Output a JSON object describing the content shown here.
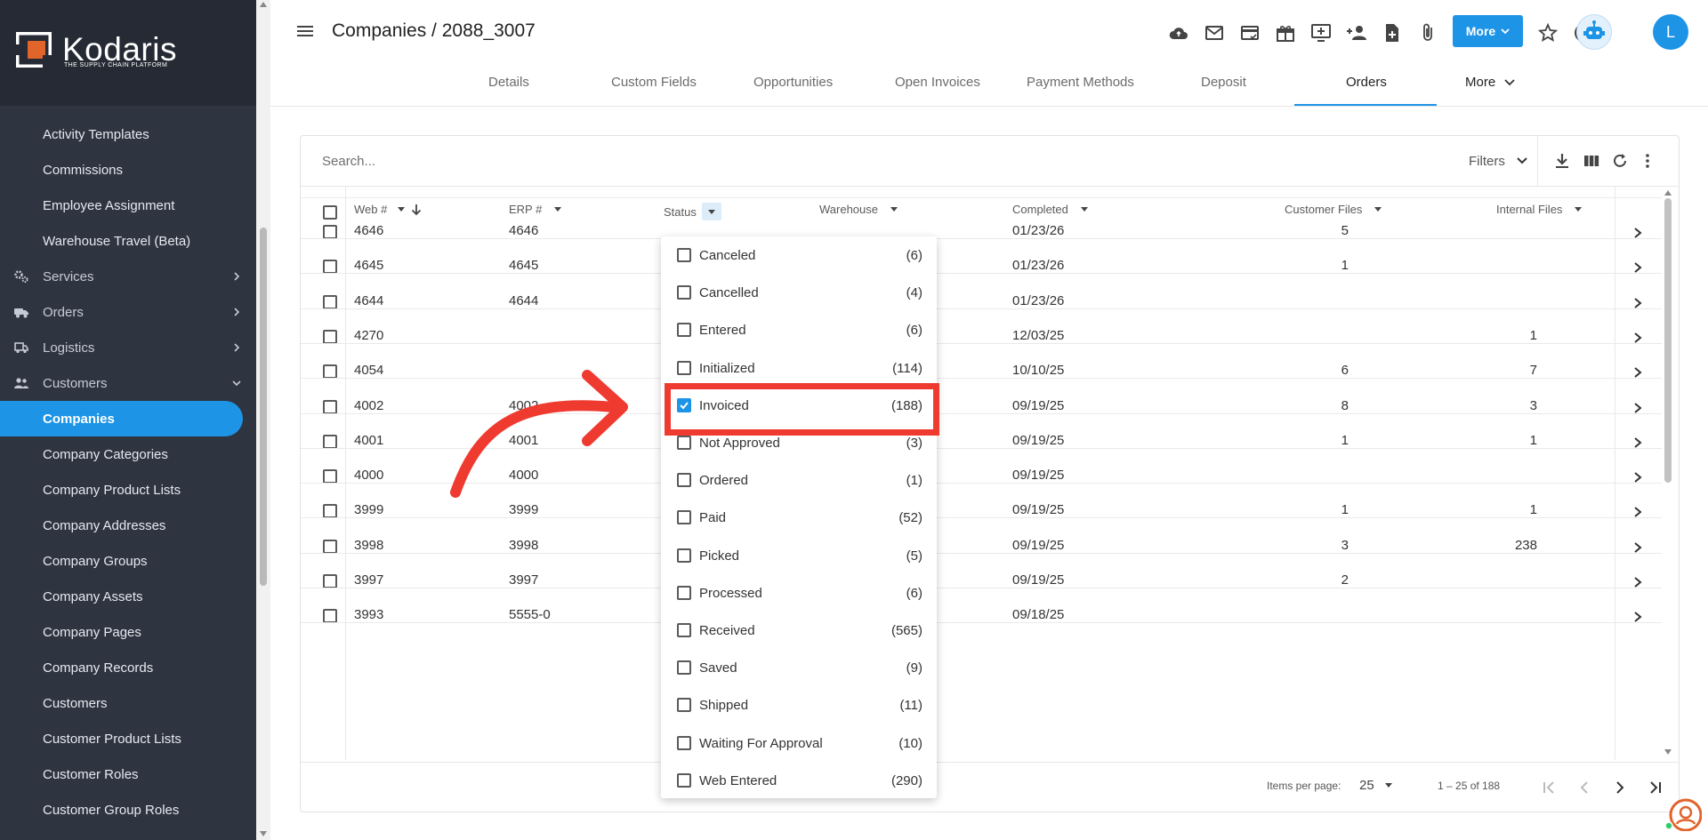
{
  "brand": {
    "name": "Kodaris",
    "tagline": "THE SUPPLY CHAIN PLATFORM"
  },
  "sidebar": {
    "items": [
      {
        "label": "Activity Templates",
        "type": "link"
      },
      {
        "label": "Commissions",
        "type": "link"
      },
      {
        "label": "Employee Assignment",
        "type": "link"
      },
      {
        "label": "Warehouse Travel (Beta)",
        "type": "link"
      },
      {
        "label": "Services",
        "type": "group",
        "icon": "gears-icon",
        "chevron": "right"
      },
      {
        "label": "Orders",
        "type": "group",
        "icon": "truck-icon",
        "chevron": "right"
      },
      {
        "label": "Logistics",
        "type": "group",
        "icon": "delivery-icon",
        "chevron": "right"
      },
      {
        "label": "Customers",
        "type": "group",
        "icon": "users-icon",
        "chevron": "down"
      },
      {
        "label": "Companies",
        "type": "link",
        "active": true
      },
      {
        "label": "Company Categories",
        "type": "link"
      },
      {
        "label": "Company Product Lists",
        "type": "link"
      },
      {
        "label": "Company Addresses",
        "type": "link"
      },
      {
        "label": "Company Groups",
        "type": "link"
      },
      {
        "label": "Company Assets",
        "type": "link"
      },
      {
        "label": "Company Pages",
        "type": "link"
      },
      {
        "label": "Company Records",
        "type": "link"
      },
      {
        "label": "Customers",
        "type": "link"
      },
      {
        "label": "Customer Product Lists",
        "type": "link"
      },
      {
        "label": "Customer Roles",
        "type": "link"
      },
      {
        "label": "Customer Group Roles",
        "type": "link"
      }
    ]
  },
  "header": {
    "title": "Companies / 2088_3007",
    "more_label": "More",
    "avatar_initial": "L",
    "icons": [
      "cloud-icon",
      "mail-icon",
      "card-icon",
      "gift-icon",
      "monitor-plus-icon",
      "add-person-icon",
      "file-plus-icon",
      "paperclip-icon",
      "star-icon",
      "help-icon",
      "bot-icon"
    ],
    "tabs": [
      "Details",
      "Custom Fields",
      "Opportunities",
      "Open Invoices",
      "Payment Methods",
      "Deposit",
      "Orders",
      "More"
    ],
    "active_tab": "Orders"
  },
  "grid": {
    "search_placeholder": "Search...",
    "filters_label": "Filters",
    "toolbar_icons": [
      "download-icon",
      "columns-icon",
      "refresh-icon",
      "more-vertical-icon"
    ],
    "columns": {
      "web": "Web #",
      "erp": "ERP #",
      "status": "Status",
      "warehouse": "Warehouse",
      "completed": "Completed",
      "customer_files": "Customer Files",
      "internal_files": "Internal Files"
    },
    "rows": [
      {
        "web": "4646",
        "erp": "4646",
        "completed": "01/23/26",
        "customer_files": "5",
        "internal_files": ""
      },
      {
        "web": "4645",
        "erp": "4645",
        "completed": "01/23/26",
        "customer_files": "1",
        "internal_files": ""
      },
      {
        "web": "4644",
        "erp": "4644",
        "completed": "01/23/26",
        "customer_files": "",
        "internal_files": ""
      },
      {
        "web": "4270",
        "erp": "",
        "completed": "12/03/25",
        "customer_files": "",
        "internal_files": "1"
      },
      {
        "web": "4054",
        "erp": "",
        "completed": "10/10/25",
        "customer_files": "6",
        "internal_files": "7"
      },
      {
        "web": "4002",
        "erp": "4002",
        "completed": "09/19/25",
        "customer_files": "8",
        "internal_files": "3"
      },
      {
        "web": "4001",
        "erp": "4001",
        "completed": "09/19/25",
        "customer_files": "1",
        "internal_files": "1"
      },
      {
        "web": "4000",
        "erp": "4000",
        "completed": "09/19/25",
        "customer_files": "",
        "internal_files": ""
      },
      {
        "web": "3999",
        "erp": "3999",
        "completed": "09/19/25",
        "customer_files": "1",
        "internal_files": "1"
      },
      {
        "web": "3998",
        "erp": "3998",
        "completed": "09/19/25",
        "customer_files": "3",
        "internal_files": "238"
      },
      {
        "web": "3997",
        "erp": "3997",
        "completed": "09/19/25",
        "customer_files": "2",
        "internal_files": ""
      },
      {
        "web": "3993",
        "erp": "5555-0",
        "completed": "09/18/25",
        "customer_files": "",
        "internal_files": ""
      }
    ],
    "pagination": {
      "items_per_page_label": "Items per page:",
      "items_per_page": "25",
      "range": "1 – 25 of 188"
    }
  },
  "status_filter": {
    "options": [
      {
        "label": "Canceled",
        "count": "(6)",
        "checked": false
      },
      {
        "label": "Cancelled",
        "count": "(4)",
        "checked": false
      },
      {
        "label": "Entered",
        "count": "(6)",
        "checked": false
      },
      {
        "label": "Initialized",
        "count": "(114)",
        "checked": false
      },
      {
        "label": "Invoiced",
        "count": "(188)",
        "checked": true
      },
      {
        "label": "Not Approved",
        "count": "(3)",
        "checked": false
      },
      {
        "label": "Ordered",
        "count": "(1)",
        "checked": false
      },
      {
        "label": "Paid",
        "count": "(52)",
        "checked": false
      },
      {
        "label": "Picked",
        "count": "(5)",
        "checked": false
      },
      {
        "label": "Processed",
        "count": "(6)",
        "checked": false
      },
      {
        "label": "Received",
        "count": "(565)",
        "checked": false
      },
      {
        "label": "Saved",
        "count": "(9)",
        "checked": false
      },
      {
        "label": "Shipped",
        "count": "(11)",
        "checked": false
      },
      {
        "label": "Waiting For Approval",
        "count": "(10)",
        "checked": false
      },
      {
        "label": "Web Entered",
        "count": "(290)",
        "checked": false
      }
    ]
  },
  "colors": {
    "accent": "#1d94e6",
    "sidebar": "#2f3441",
    "highlight": "#ef3a30"
  }
}
